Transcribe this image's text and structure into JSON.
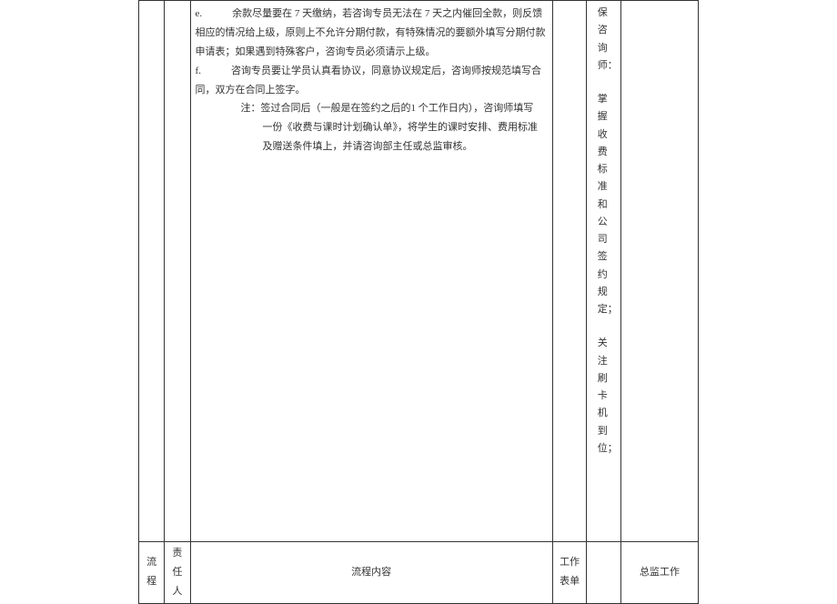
{
  "main": {
    "para_e": "e.　　　余款尽量要在 7 天缴纳，若咨询专员无法在 7 天之内催回全款，则反馈相应的情况给上级，原则上不允许分期付款，有特殊情况的要额外填写分期付款申请表；如果遇到特殊客户，咨询专员必须请示上级。",
    "para_f": "f.　　　咨询专员要让学员认真看协议，同意协议规定后，咨询师按规范填写合同，双方在合同上签字。",
    "note": "注：签过合同后（一般是在签约之后的1 个工作日内），咨询师填写一份《收费与课时计划确认单》，将学生的课时安排、费用标准及赠送条件填上，并请咨询部主任或总监审核。"
  },
  "col5_text1": "保咨询师：",
  "col5_text2": "掌握收费标准和公司签约规定；",
  "col5_text3": "关注刷卡机到位；",
  "header": {
    "c1": "流程",
    "c2": "责任人",
    "c3": "流程内容",
    "c4": "工作表单",
    "c5": "",
    "c6": "总监工作"
  }
}
